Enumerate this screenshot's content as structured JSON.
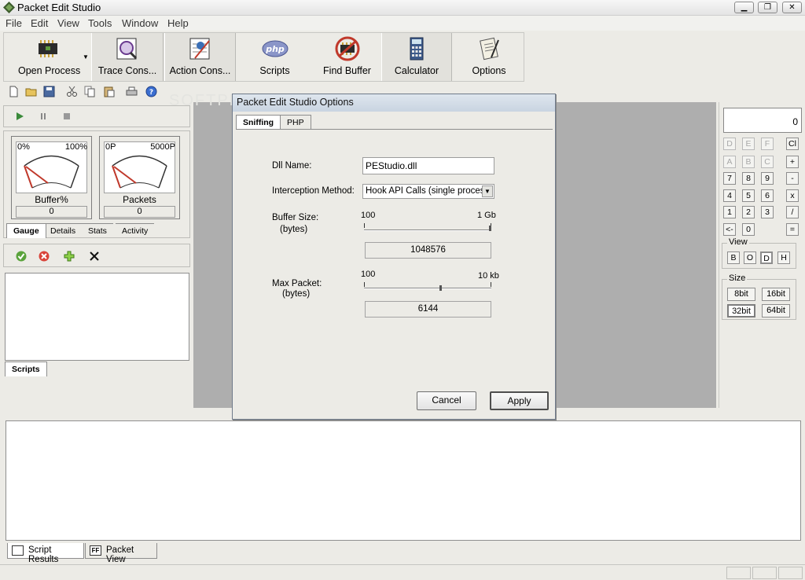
{
  "window": {
    "title": "Packet Edit Studio"
  },
  "menu": [
    "File",
    "Edit",
    "View",
    "Tools",
    "Window",
    "Help"
  ],
  "toolbar": {
    "buttons": [
      {
        "label": "Open Process",
        "icon": "chip-icon"
      },
      {
        "label": "Trace Cons...",
        "icon": "trace-icon"
      },
      {
        "label": "Action Cons...",
        "icon": "action-icon"
      },
      {
        "label": "Scripts",
        "icon": "php-icon"
      },
      {
        "label": "Find Buffer",
        "icon": "find-chip-icon"
      },
      {
        "label": "Calculator",
        "icon": "calculator-icon"
      },
      {
        "label": "Options",
        "icon": "options-icon"
      }
    ]
  },
  "gauges": [
    {
      "name": "Buffer%",
      "min": "0%",
      "max": "100%",
      "value": "0"
    },
    {
      "name": "Packets",
      "min": "0P",
      "max": "5000P",
      "value": "0"
    }
  ],
  "leftTabs": [
    "Gauge",
    "Details",
    "Stats",
    "Activity"
  ],
  "scriptTab": "Scripts",
  "bottomTabs": [
    "Script Results",
    "Packet View"
  ],
  "calculator": {
    "display": "0",
    "hexRow": [
      "D",
      "E",
      "F",
      "Cl"
    ],
    "abcRow": [
      "A",
      "B",
      "C",
      "+"
    ],
    "row789": [
      "7",
      "8",
      "9",
      "-"
    ],
    "row456": [
      "4",
      "5",
      "6",
      "x"
    ],
    "row123": [
      "1",
      "2",
      "3",
      "/"
    ],
    "row0": [
      "<-",
      "0",
      "="
    ],
    "viewLabel": "View",
    "viewButtons": [
      "B",
      "O",
      "D",
      "H"
    ],
    "sizeLabel": "Size",
    "sizeButtons": [
      "8bit",
      "16bit",
      "32bit",
      "64bit"
    ]
  },
  "dialog": {
    "title": "Packet Edit Studio Options",
    "tabs": [
      "Sniffing",
      "PHP"
    ],
    "dllName": {
      "label": "Dll Name:",
      "value": "PEStudio.dll"
    },
    "interception": {
      "label": "Interception Method:",
      "value": "Hook API Calls (single process)"
    },
    "bufferSize": {
      "label": "Buffer Size:",
      "unit": "(bytes)",
      "min": "100",
      "max": "1 Gb",
      "value": "1048576"
    },
    "maxPacket": {
      "label": "Max Packet:",
      "unit": "(bytes)",
      "min": "100",
      "max": "10 kb",
      "value": "6144"
    },
    "cancel": "Cancel",
    "apply": "Apply"
  },
  "watermark": "SOFTPEDIA"
}
